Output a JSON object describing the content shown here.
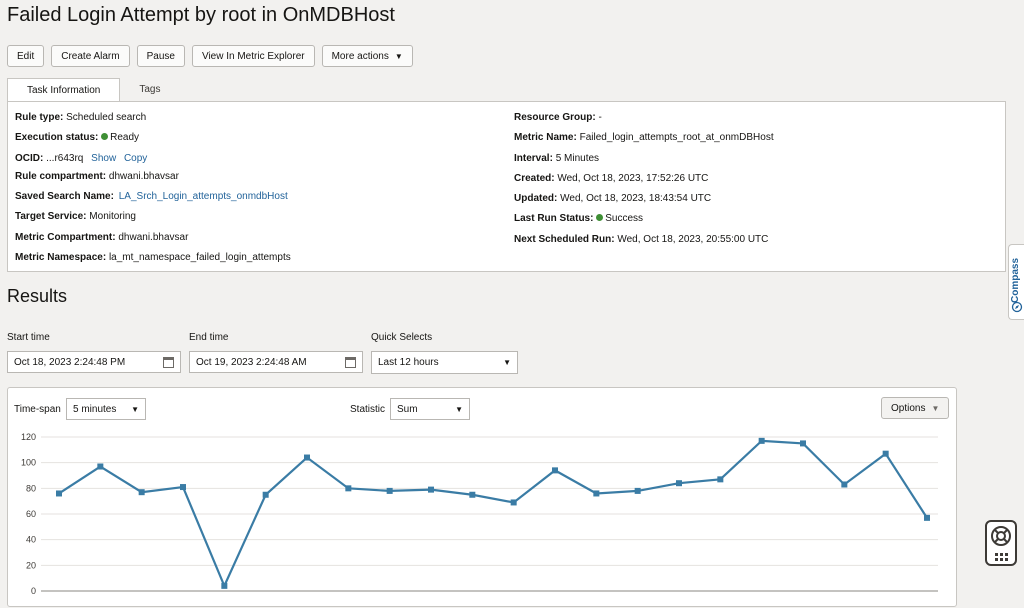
{
  "page": {
    "title": "Failed Login Attempt by root in OnMDBHost"
  },
  "toolbar": {
    "edit": "Edit",
    "create_alarm": "Create Alarm",
    "pause": "Pause",
    "view_metric": "View In Metric Explorer",
    "more_actions": "More actions"
  },
  "tabs": {
    "task_info": "Task Information",
    "tags": "Tags"
  },
  "info": {
    "rule_type_label": "Rule type:",
    "rule_type": "Scheduled search",
    "exec_status_label": "Execution status:",
    "exec_status": "Ready",
    "ocid_label": "OCID:",
    "ocid": "...r643rq",
    "ocid_show": "Show",
    "ocid_copy": "Copy",
    "rule_compartment_label": "Rule compartment:",
    "rule_compartment": "dhwani.bhavsar",
    "saved_search_label": "Saved Search Name:",
    "saved_search": "LA_Srch_Login_attempts_onmdbHost",
    "target_service_label": "Target Service:",
    "target_service": "Monitoring",
    "metric_compartment_label": "Metric Compartment:",
    "metric_compartment": "dhwani.bhavsar",
    "metric_namespace_label": "Metric Namespace:",
    "metric_namespace": "la_mt_namespace_failed_login_attempts",
    "resource_group_label": "Resource Group:",
    "resource_group": "-",
    "metric_name_label": "Metric Name:",
    "metric_name": "Failed_login_attempts_root_at_onmDBHost",
    "interval_label": "Interval:",
    "interval": "5 Minutes",
    "created_label": "Created:",
    "created": "Wed, Oct 18, 2023, 17:52:26 UTC",
    "updated_label": "Updated:",
    "updated": "Wed, Oct 18, 2023, 18:43:54 UTC",
    "last_run_label": "Last Run Status:",
    "last_run": "Success",
    "next_run_label": "Next Scheduled Run:",
    "next_run": "Wed, Oct 18, 2023, 20:55:00 UTC"
  },
  "results": {
    "title": "Results",
    "start_label": "Start time",
    "start_value": "Oct 18, 2023 2:24:48 PM",
    "end_label": "End time",
    "end_value": "Oct 19, 2023 2:24:48 AM",
    "quick_label": "Quick Selects",
    "quick_value": "Last 12 hours",
    "timespan_label": "Time-span",
    "timespan_value": "5 minutes",
    "statistic_label": "Statistic",
    "statistic_value": "Sum",
    "options_label": "Options"
  },
  "compass": {
    "label": "Compass"
  },
  "colors": {
    "line": "#3a7ca5",
    "accent": "#22639a",
    "success": "#3f8f35"
  },
  "chart_data": {
    "type": "line",
    "ylim": [
      0,
      120
    ],
    "y_ticks": [
      "120",
      "100",
      "80",
      "60",
      "40",
      "20",
      "0"
    ],
    "series": [
      {
        "values": [
          76,
          97,
          77,
          81,
          4,
          75,
          104,
          80,
          78,
          79,
          75,
          69,
          94,
          76,
          78,
          84,
          87,
          117,
          115,
          83,
          107,
          57
        ]
      }
    ]
  }
}
